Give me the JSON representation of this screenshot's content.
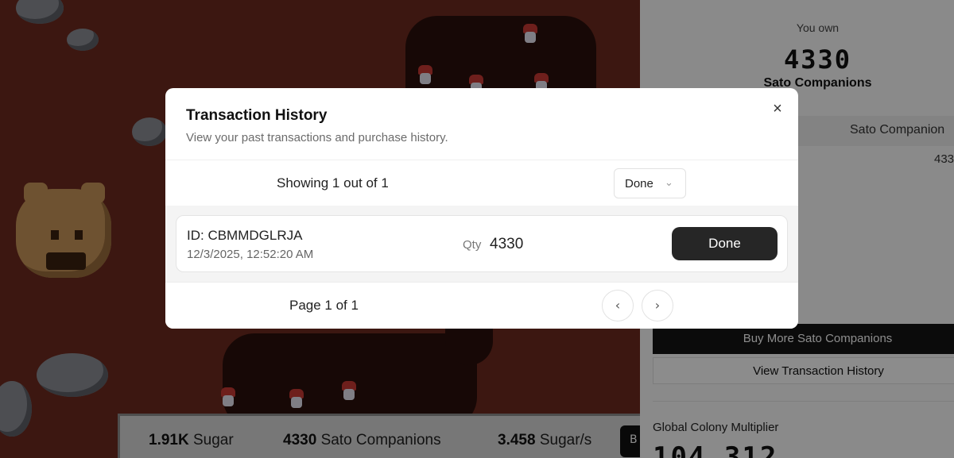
{
  "game": {
    "stats": [
      {
        "value": "1.91K",
        "label": "Sugar"
      },
      {
        "value": "4330",
        "label": "Sato Companions"
      },
      {
        "value": "3.458",
        "label": "Sugar/s"
      }
    ],
    "cut_button_label": "B"
  },
  "sidebar": {
    "you_own_label": "You own",
    "count": "4330",
    "unit": "Sato Companions",
    "table_header": "Sato Companion",
    "table_value": "433",
    "buy_button": "Buy More Sato Companions",
    "view_history_button": "View Transaction History",
    "multiplier_label": "Global Colony Multiplier",
    "multiplier_value": "104.312"
  },
  "modal": {
    "title": "Transaction History",
    "subtitle": "View your past transactions and purchase history.",
    "close_icon": "×",
    "showing_text": "Showing 1 out of 1",
    "filter": {
      "selected": "Done",
      "chevron": "⌄"
    },
    "transactions": [
      {
        "id": "ID: CBMMDGLRJA",
        "date": "12/3/2025, 12:52:20 AM",
        "qty_label": "Qty",
        "qty": "4330",
        "status": "Done"
      }
    ],
    "pagination": {
      "text": "Page 1 of 1",
      "prev_icon": "‹",
      "next_icon": "›"
    }
  },
  "colors": {
    "overlay": "rgba(0,0,0,0.45)",
    "primary_button": "#262626",
    "game_dirt": "#6e2a1f"
  }
}
